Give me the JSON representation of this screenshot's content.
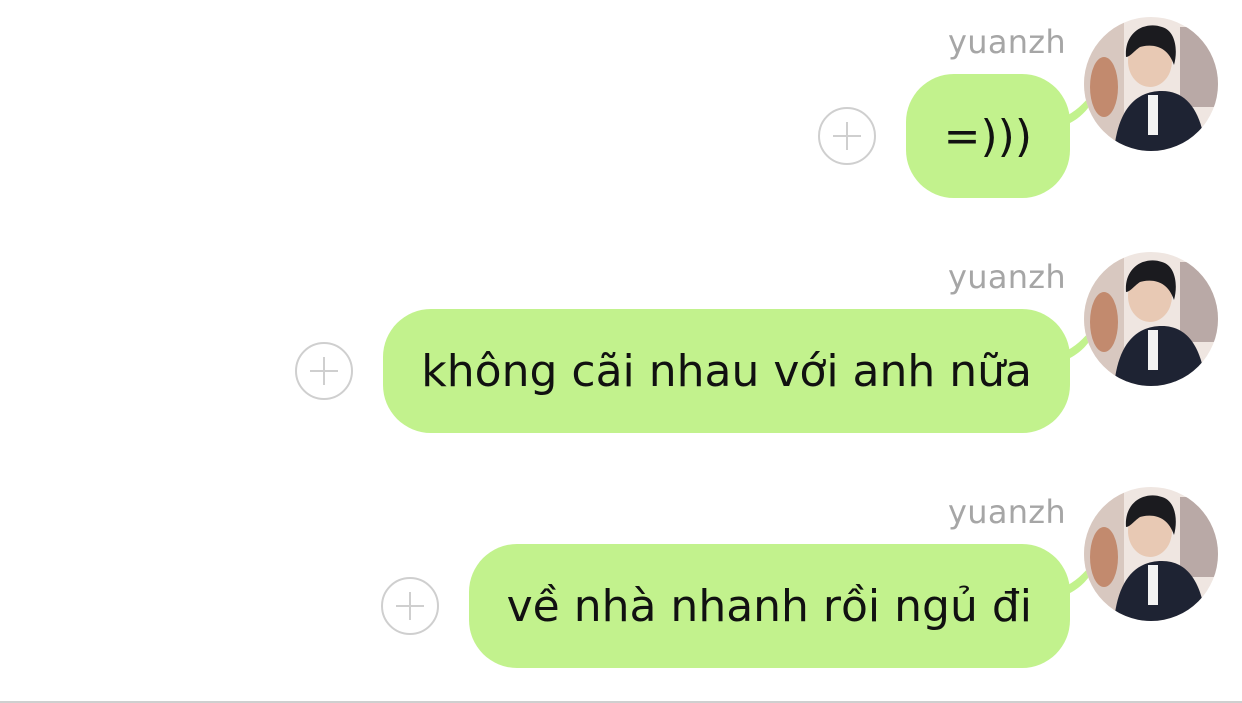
{
  "messages": [
    {
      "sender": "yuanzh",
      "text": "=)))"
    },
    {
      "sender": "yuanzh",
      "text": "không cãi nhau với anh nữa"
    },
    {
      "sender": "yuanzh",
      "text": "về nhà nhanh rồi ngủ đi"
    }
  ],
  "icons": {
    "add": "plus-circle-icon",
    "avatar": "user-avatar-photo"
  },
  "colors": {
    "bubble": "#c2f28d",
    "sender_name": "#a6a6a6",
    "plus_icon": "#cfcfcf",
    "background": "#ffffff"
  }
}
